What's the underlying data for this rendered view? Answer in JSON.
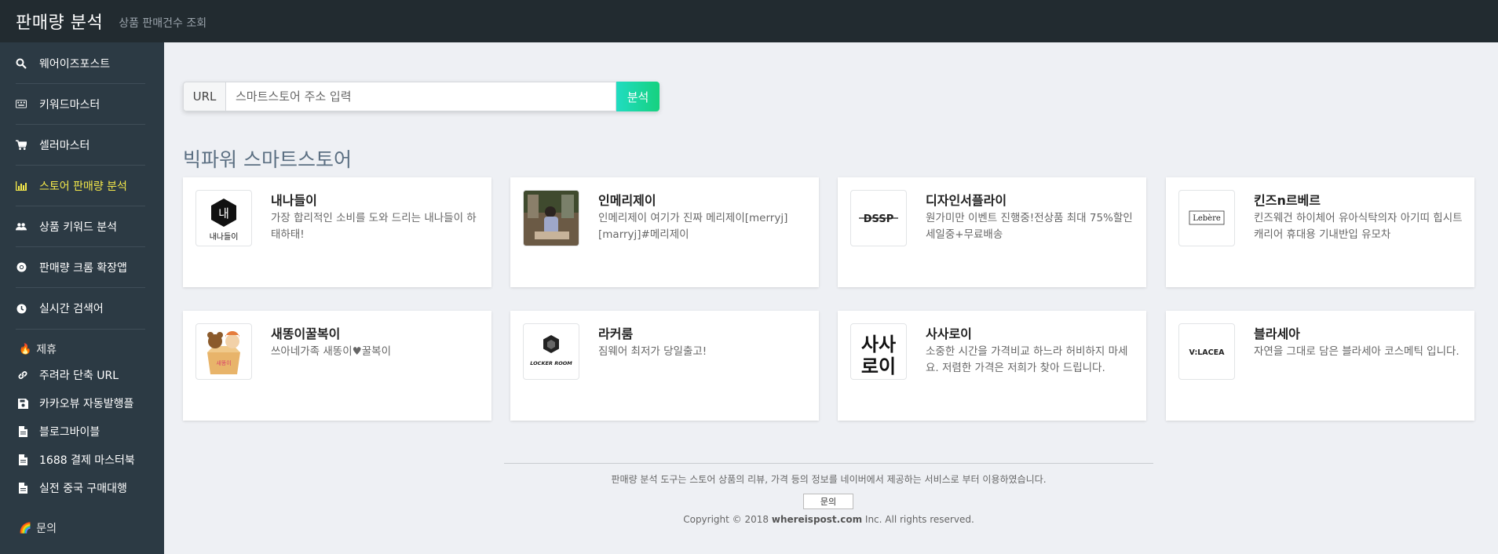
{
  "header": {
    "title": "판매량 분석",
    "subtitle": "상품 판매건수 조회"
  },
  "sidebar": {
    "items": [
      {
        "label": "웨어이즈포스트",
        "icon": "search-icon"
      },
      {
        "label": "키워드마스터",
        "icon": "keyboard-icon"
      },
      {
        "label": "셀러마스터",
        "icon": "cart-icon"
      },
      {
        "label": "스토어 판매량 분석",
        "icon": "bar-chart-icon",
        "active": true
      },
      {
        "label": "상품 키워드 분석",
        "icon": "users-icon"
      },
      {
        "label": "판매량 크롬 확장앱",
        "icon": "chrome-icon"
      },
      {
        "label": "실시간 검색어",
        "icon": "clock-icon"
      }
    ],
    "partner_section": "제휴",
    "partner_links": [
      {
        "label": "주려라 단축 URL",
        "icon": "link-icon"
      },
      {
        "label": "카카오뷰 자동발행플",
        "icon": "save-icon"
      },
      {
        "label": "블로그바이블",
        "icon": "file-icon"
      },
      {
        "label": "1688 결제 마스터북",
        "icon": "file-icon"
      },
      {
        "label": "실전 중국 구매대행",
        "icon": "file-icon"
      }
    ],
    "contact_section": "문의"
  },
  "search": {
    "addon_label": "URL",
    "placeholder": "스마트스토어 주소 입력",
    "value": "",
    "button_label": "분석"
  },
  "section_title": "빅파워 스마트스토어",
  "stores": [
    {
      "name": "내나들이",
      "desc": "가장 합리적인 소비를 도와 드리는 내나들이 하태하태!",
      "logo_text": "내",
      "logo_caption": "내나들이"
    },
    {
      "name": "인메리제이",
      "desc": "인메리제이 여기가 진짜 메리제이[merryj][marryj]#메리제이"
    },
    {
      "name": "디자인서플라이",
      "desc": "원가미만 이벤트 진행중!전상품 최대 75%할인 세일중+무료배송",
      "logo_text": "DSSP"
    },
    {
      "name": "킨즈n르베르",
      "desc": "킨즈웨건 하이체어 유아식탁의자 아기띠 힙시트캐리어 휴대용 기내반입 유모차",
      "logo_text": "Lebère"
    },
    {
      "name": "새똥이꿀복이",
      "desc": "쓰아네가족 새똥이♥꿀복이"
    },
    {
      "name": "라커룸",
      "desc": "짐웨어 최저가 당일출고!",
      "logo_text": "LOCKER ROOM"
    },
    {
      "name": "사사로이",
      "desc": "소중한 시간을 가격비교 하느라 허비하지 마세요. 저렴한 가격은 저희가 찾아 드립니다.",
      "logo_text": "사사로이"
    },
    {
      "name": "블라세아",
      "desc": "자연을 그대로 담은 블라세아 코스메틱 입니다.",
      "logo_text": "V:LACEA"
    }
  ],
  "footer": {
    "notice": "판매량 분석 도구는 스토어 상품의 리뷰, 가격 등의 정보를 네이버에서 제공하는 서비스로 부터 이용하였습니다.",
    "contact_button": "문의",
    "copyright_prefix": "Copyright © 2018",
    "copyright_brand": "whereispost.com",
    "copyright_suffix": "Inc. All rights reserved."
  },
  "colors": {
    "topbar": "#222b30",
    "sidebar": "#2c3a44",
    "active_nav": "#f5e94a",
    "search_button": "#16d17f"
  }
}
